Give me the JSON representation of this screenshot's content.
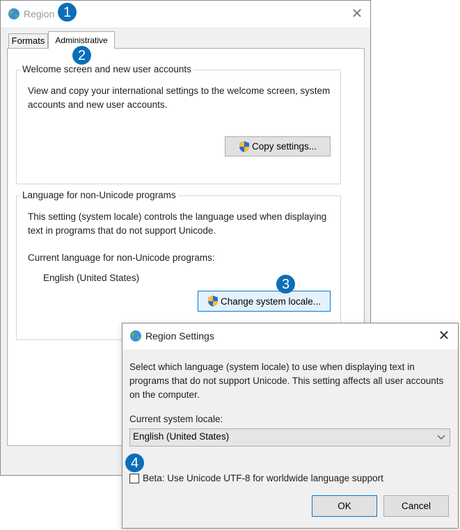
{
  "region_window": {
    "title": "Region",
    "close_glyph": "✕",
    "tabs": [
      {
        "label": "Formats",
        "selected": false
      },
      {
        "label": "Administrative",
        "selected": true
      }
    ],
    "welcome_group": {
      "legend": "Welcome screen and new user accounts",
      "description": "View and copy your international settings to the welcome screen, system accounts and new user accounts.",
      "copy_button": "Copy settings..."
    },
    "nonunicode_group": {
      "legend": "Language for non-Unicode programs",
      "description": "This setting (system locale) controls the language used when displaying text in programs that do not support Unicode.",
      "current_label": "Current language for non-Unicode programs:",
      "current_value": "English (United States)",
      "change_button": "Change system locale..."
    }
  },
  "settings_dialog": {
    "title": "Region Settings",
    "close_glyph": "✕",
    "description": "Select which language (system locale) to use when displaying text in programs that do not support Unicode. This setting affects all user accounts on the computer.",
    "locale_label": "Current system locale:",
    "locale_value": "English (United States)",
    "utf8_label": "Beta: Use Unicode UTF-8 for worldwide language support",
    "utf8_checked": false,
    "ok_button": "OK",
    "cancel_button": "Cancel"
  },
  "callouts": [
    "1",
    "2",
    "3",
    "4"
  ],
  "icons": {
    "window_icon": "globe-icon",
    "admin_buttons": "uac-shield-icon",
    "dropdown": "chevron-down-icon"
  },
  "colors": {
    "callout": "#0a6fb8",
    "focus_border": "#0078d7",
    "window_bg": "#f0f0f0"
  }
}
